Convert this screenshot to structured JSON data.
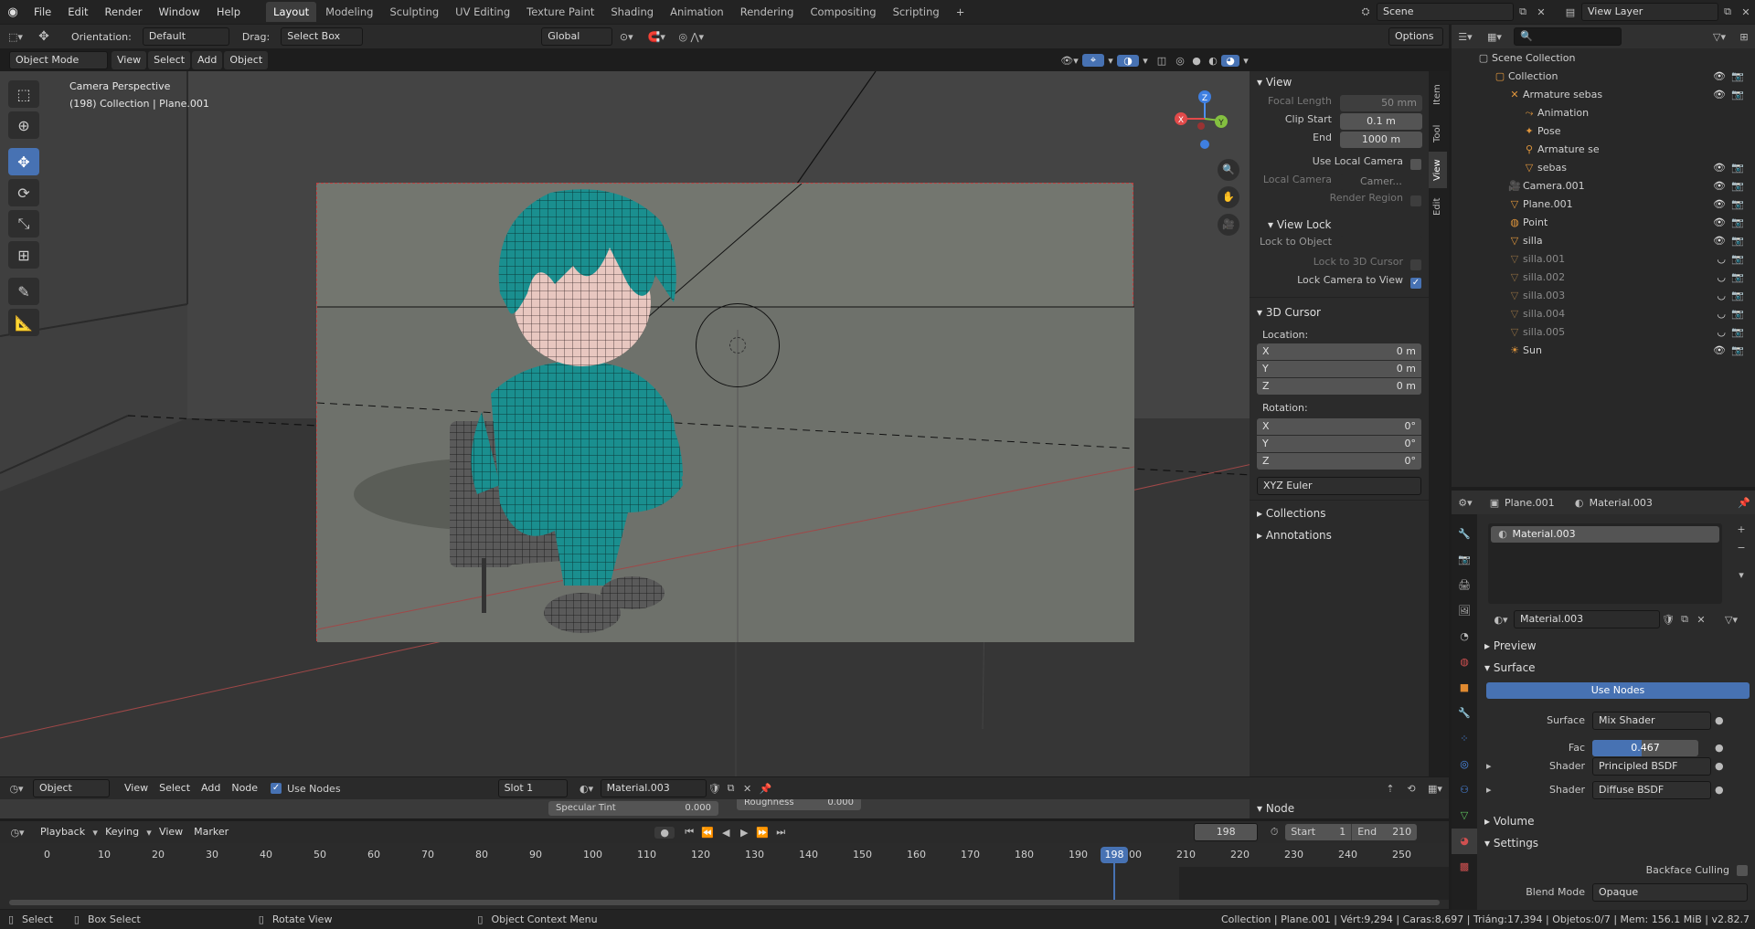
{
  "topbar": {
    "menus": [
      "File",
      "Edit",
      "Render",
      "Window",
      "Help"
    ],
    "tabs": [
      "Layout",
      "Modeling",
      "Sculpting",
      "UV Editing",
      "Texture Paint",
      "Shading",
      "Animation",
      "Rendering",
      "Compositing",
      "Scripting"
    ],
    "active_tab": "Layout",
    "add_tab": "+",
    "scene_label": "Scene",
    "view_layer_label": "View Layer"
  },
  "viewport_header": {
    "orientation_label": "Orientation:",
    "orientation_value": "Default",
    "drag_label": "Drag:",
    "drag_value": "Select Box",
    "transform_value": "Global",
    "options_label": "Options",
    "mode": "Object Mode",
    "menus": [
      "View",
      "Select",
      "Add",
      "Object"
    ]
  },
  "viewport": {
    "camera_text": "Camera Perspective",
    "collection_text": "(198) Collection | Plane.001",
    "gizmo": {
      "x": "X",
      "y": "Y",
      "z": "Z"
    }
  },
  "npanel": {
    "tabs": [
      "Item",
      "Tool",
      "View",
      "Edit"
    ],
    "active_tab": "View",
    "view": {
      "title": "View",
      "focal_length_label": "Focal Length",
      "focal_length_value": "50 mm",
      "clip_start_label": "Clip Start",
      "clip_start_value": "0.1 m",
      "end_label": "End",
      "end_value": "1000 m",
      "use_local_camera": "Use Local Camera",
      "local_camera_label": "Local Camera",
      "local_camera_value": "Camer...",
      "render_region": "Render Region"
    },
    "view_lock": {
      "title": "View Lock",
      "lock_to_object": "Lock to Object",
      "lock_to_cursor": "Lock to 3D Cursor",
      "lock_camera_to_view": "Lock Camera to View"
    },
    "cursor": {
      "title": "3D Cursor",
      "location_label": "Location:",
      "location": [
        {
          "axis": "X",
          "value": "0 m"
        },
        {
          "axis": "Y",
          "value": "0 m"
        },
        {
          "axis": "Z",
          "value": "0 m"
        }
      ],
      "rotation_label": "Rotation:",
      "rotation": [
        {
          "axis": "X",
          "value": "0°"
        },
        {
          "axis": "Y",
          "value": "0°"
        },
        {
          "axis": "Z",
          "value": "0°"
        }
      ],
      "rotation_mode": "XYZ Euler"
    },
    "collections": "Collections",
    "annotations": "Annotations",
    "node_panel": "Node"
  },
  "outliner": {
    "root": "Scene Collection",
    "items": [
      {
        "name": "Collection",
        "depth": 1,
        "dim": false,
        "vis": true
      },
      {
        "name": "Armature sebas",
        "depth": 2,
        "dim": false,
        "vis": true
      },
      {
        "name": "Animation",
        "depth": 3,
        "dim": false,
        "vis": false
      },
      {
        "name": "Pose",
        "depth": 3,
        "dim": false,
        "vis": false
      },
      {
        "name": "Armature se",
        "depth": 3,
        "dim": false,
        "vis": false
      },
      {
        "name": "sebas",
        "depth": 3,
        "dim": false,
        "vis": true
      },
      {
        "name": "Camera.001",
        "depth": 2,
        "dim": false,
        "vis": true
      },
      {
        "name": "Plane.001",
        "depth": 2,
        "dim": false,
        "vis": true
      },
      {
        "name": "Point",
        "depth": 2,
        "dim": false,
        "vis": true
      },
      {
        "name": "silla",
        "depth": 2,
        "dim": false,
        "vis": true
      },
      {
        "name": "silla.001",
        "depth": 2,
        "dim": true,
        "vis": true
      },
      {
        "name": "silla.002",
        "depth": 2,
        "dim": true,
        "vis": true
      },
      {
        "name": "silla.003",
        "depth": 2,
        "dim": true,
        "vis": true
      },
      {
        "name": "silla.004",
        "depth": 2,
        "dim": true,
        "vis": true
      },
      {
        "name": "silla.005",
        "depth": 2,
        "dim": true,
        "vis": true
      },
      {
        "name": "Sun",
        "depth": 2,
        "dim": false,
        "vis": true
      }
    ]
  },
  "properties": {
    "object_name": "Plane.001",
    "material_name": "Material.003",
    "slot_name": "Material.003",
    "preview": "Preview",
    "surface": "Surface",
    "use_nodes": "Use Nodes",
    "surface_label": "Surface",
    "surface_value": "Mix Shader",
    "fac_label": "Fac",
    "fac_value": "0.467",
    "fac_fraction": 0.467,
    "shader_label": "Shader",
    "shader1_value": "Principled BSDF",
    "shader2_value": "Diffuse BSDF",
    "volume": "Volume",
    "settings": "Settings",
    "backface_label": "Backface Culling",
    "blend_label": "Blend Mode",
    "blend_value": "Opaque"
  },
  "shader_editor": {
    "mode": "Object",
    "menus": [
      "View",
      "Select",
      "Add",
      "Node"
    ],
    "use_nodes": "Use Nodes",
    "slot": "Slot 1",
    "material": "Material.003",
    "specular_tint_label": "Specular Tint",
    "specular_tint_value": "0.000",
    "roughness_label": "Roughness",
    "roughness_value": "0.000"
  },
  "timeline": {
    "menus": [
      "Playback",
      "Keying",
      "View",
      "Marker"
    ],
    "current_frame": "198",
    "start_label": "Start",
    "start_value": "1",
    "end_label": "End",
    "end_value": "210",
    "ticks": [
      "0",
      "10",
      "20",
      "30",
      "40",
      "50",
      "60",
      "70",
      "80",
      "90",
      "100",
      "110",
      "120",
      "130",
      "140",
      "150",
      "160",
      "170",
      "180",
      "190",
      "200",
      "210",
      "220",
      "230",
      "240",
      "250"
    ],
    "playhead_label": "198"
  },
  "statusbar": {
    "select": "Select",
    "box_select": "Box Select",
    "rotate_view": "Rotate View",
    "context_menu": "Object Context Menu",
    "stats": "Collection | Plane.001 | Vért:9,294 | Caras:8,697 | Triáng:17,394 | Objetos:0/7 | Mem: 156.1 MiB | v2.82.7"
  },
  "colors": {
    "accent": "#4772b3",
    "background": "#1d1d1d",
    "viewport": "#3a3a3a",
    "character": "#1a8f8f"
  }
}
